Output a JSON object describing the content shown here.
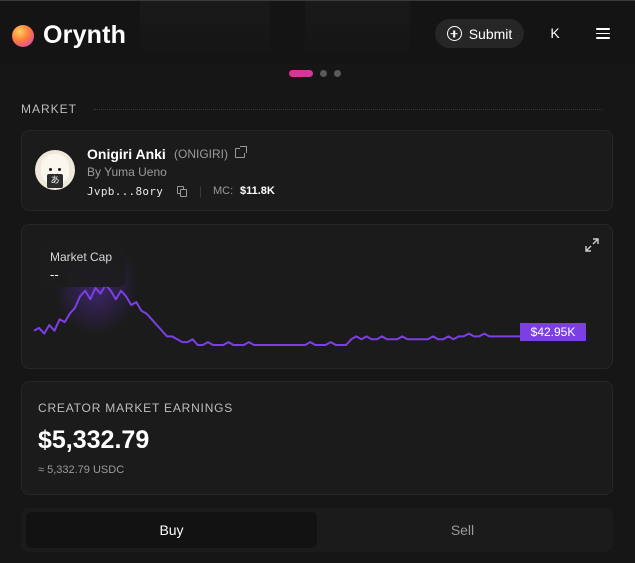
{
  "header": {
    "brand": "Orynth",
    "submit_label": "Submit",
    "user_initial": "K",
    "icons": {
      "logo": "brand-logo-icon",
      "submit": "plus-circle-icon",
      "menu": "hamburger-menu-icon"
    },
    "carousel": {
      "pages": 3,
      "active": 0
    }
  },
  "market": {
    "section_label": "MARKET",
    "token": {
      "name": "Onigiri Anki",
      "symbol": "(ONIGIRI)",
      "creator": "By Yuma Ueno",
      "address": "Jvpb...8ory",
      "mc_label": "MC:",
      "mc_value": "$11.8K",
      "avatar_glyph": "あ"
    },
    "chart": {
      "tooltip_label": "Market Cap",
      "tooltip_value": "--",
      "current_price_label": "$42.95K",
      "line_color": "#7b3fe4",
      "label_bg": "#7b3fe4"
    }
  },
  "earnings": {
    "label": "CREATOR MARKET EARNINGS",
    "value": "$5,332.79",
    "sub": "≈ 5,332.79 USDC"
  },
  "trade": {
    "buy_label": "Buy",
    "sell_label": "Sell",
    "active": "buy"
  },
  "colors": {
    "background": "#161616",
    "card": "#1b1b1b",
    "accent_pink": "#d6359a",
    "accent_purple": "#7b3fe4"
  },
  "chart_data": {
    "type": "line",
    "series": [
      {
        "values": [
          13,
          14,
          12,
          15,
          13,
          17,
          16,
          19,
          21,
          25,
          27,
          24,
          28,
          26,
          29,
          27,
          24,
          27,
          25,
          22,
          23,
          20,
          19,
          17,
          15,
          13,
          11,
          11,
          10,
          9,
          9,
          10,
          8,
          8,
          9,
          8,
          8,
          8,
          9,
          8,
          8,
          8,
          9,
          8,
          8,
          8,
          8,
          8,
          8,
          8,
          8,
          8,
          8,
          8,
          9,
          8,
          8,
          8,
          9,
          8,
          8,
          8,
          10,
          11,
          10,
          11,
          10,
          10,
          11,
          10,
          10,
          10,
          11,
          10,
          10,
          10,
          10,
          10,
          11,
          10,
          10,
          11,
          10,
          11,
          11,
          12,
          11,
          11,
          12,
          11,
          11,
          11,
          11,
          11,
          11,
          11
        ]
      }
    ],
    "current_label": "$42.95K",
    "grid": false,
    "title": "Market Cap"
  }
}
